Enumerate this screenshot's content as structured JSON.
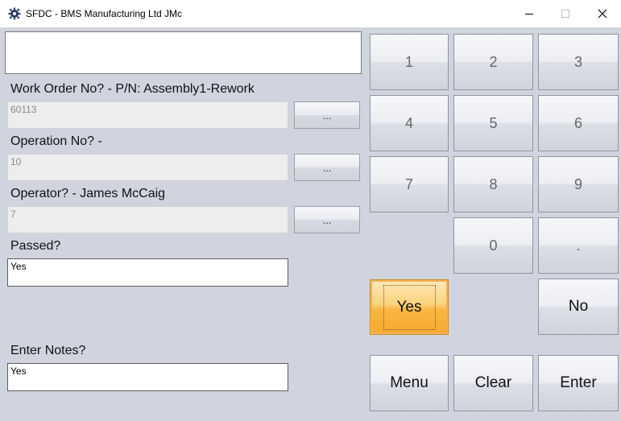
{
  "window": {
    "title": "SFDC - BMS Manufacturing Ltd JMc"
  },
  "message_box": {
    "value": ""
  },
  "fields": {
    "work_order": {
      "label": "Work Order No? - P/N: Assembly1-Rework",
      "value": "60113",
      "browse_label": "..."
    },
    "operation": {
      "label": "Operation No? -",
      "value": "10",
      "browse_label": "..."
    },
    "operator": {
      "label": "Operator? - James McCaig",
      "value": "7",
      "browse_label": "..."
    },
    "passed": {
      "label": "Passed?",
      "value": "Yes"
    },
    "notes": {
      "label": "Enter Notes?",
      "value": "Yes"
    }
  },
  "keypad": {
    "k1": "1",
    "k2": "2",
    "k3": "3",
    "k4": "4",
    "k5": "5",
    "k6": "6",
    "k7": "7",
    "k8": "8",
    "k9": "9",
    "k0": "0",
    "kdot": ".",
    "yes": "Yes",
    "no": "No",
    "menu": "Menu",
    "clear": "Clear",
    "enter": "Enter"
  },
  "colors": {
    "background": "#cfd4de",
    "yes_button": "#f9b640"
  },
  "icons": {
    "app": "gear-icon",
    "minimize": "minimize-icon",
    "maximize": "maximize-icon",
    "close": "close-icon"
  }
}
